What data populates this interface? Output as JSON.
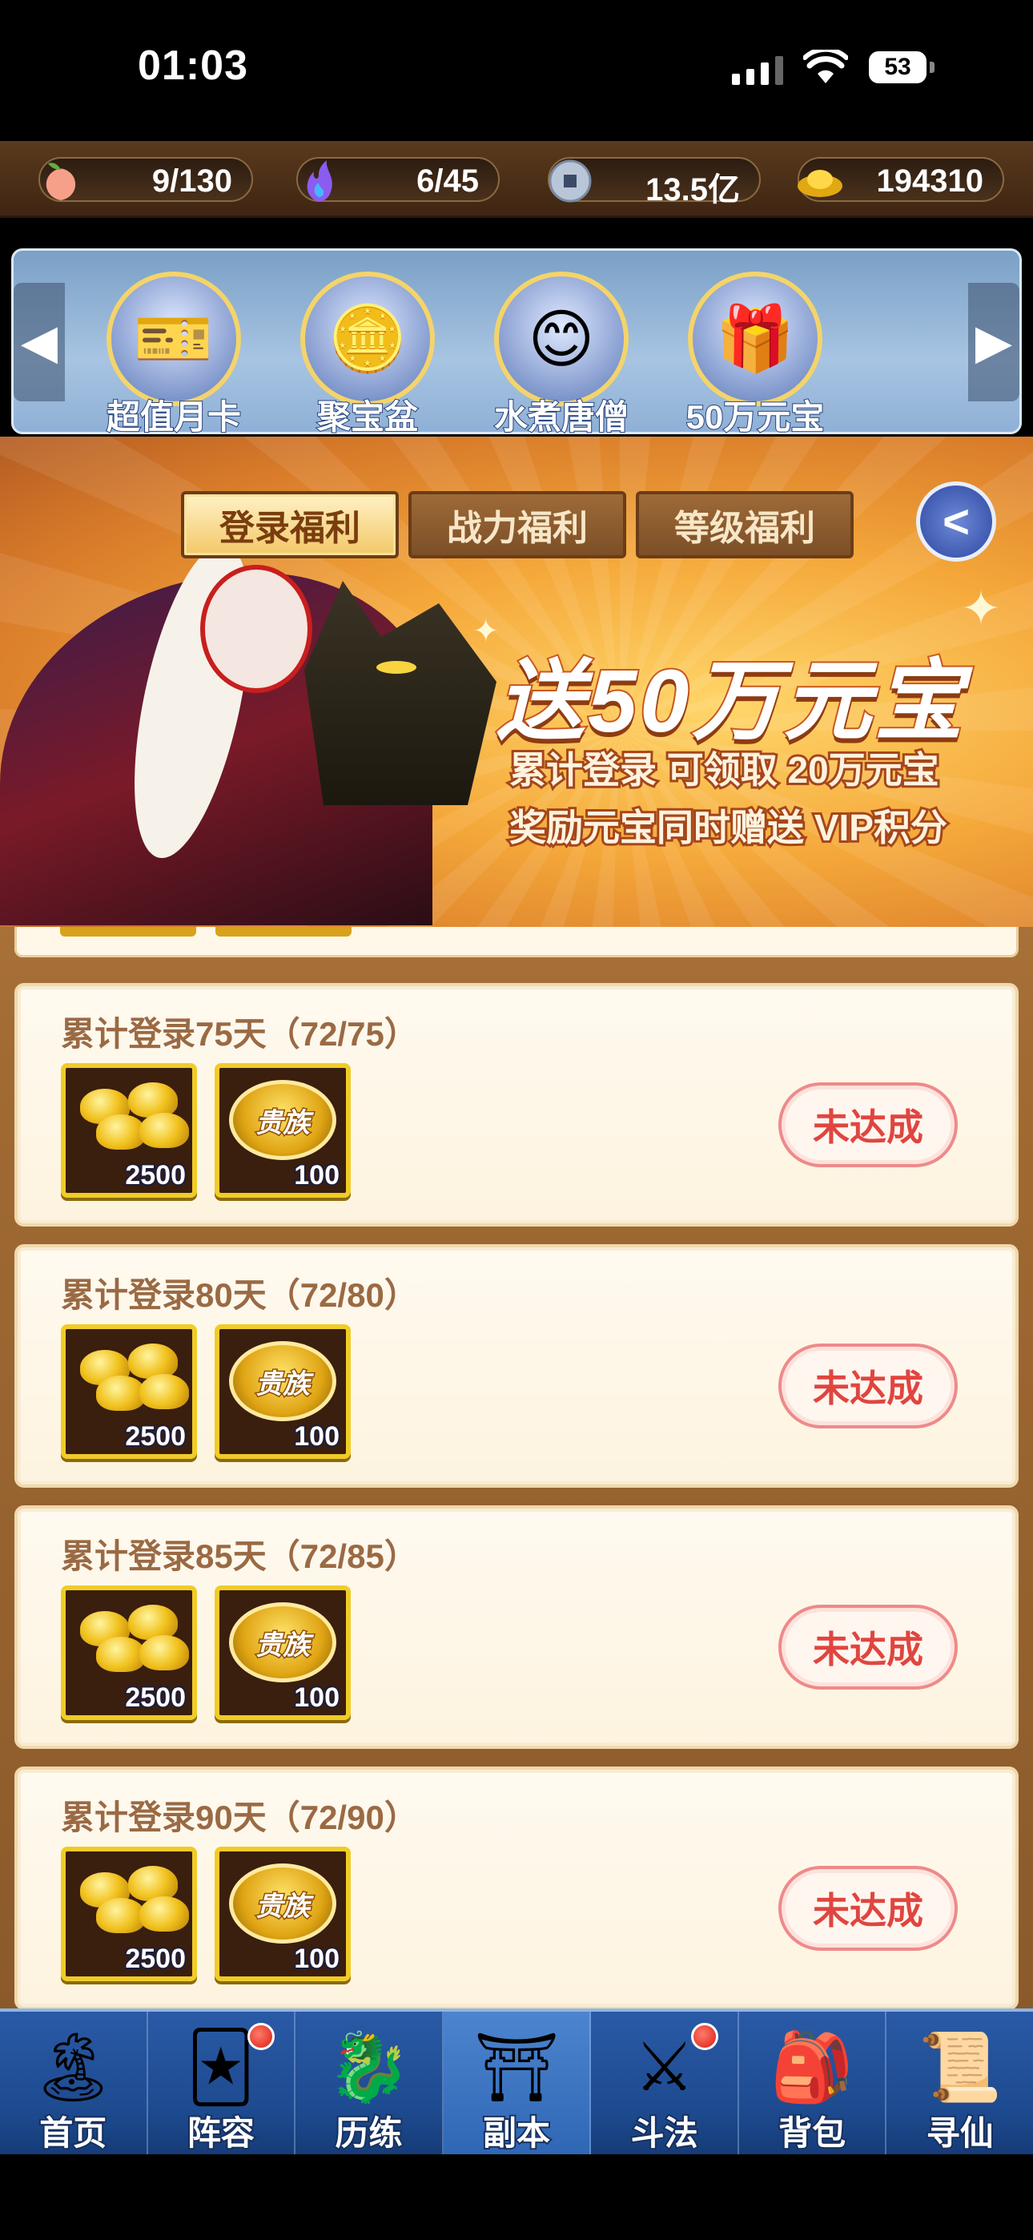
{
  "status_bar": {
    "time": "01:03",
    "battery": "53"
  },
  "resources": [
    {
      "icon": "peach-icon",
      "value": "9/130"
    },
    {
      "icon": "spirit-flame-icon",
      "value": "6/45"
    },
    {
      "icon": "copper-coin-icon",
      "value": "13.5亿"
    },
    {
      "icon": "gold-ingot-icon",
      "value": "194310"
    }
  ],
  "activities": [
    {
      "label": "超值月卡",
      "icon": "monthly-card-icon"
    },
    {
      "label": "聚宝盆",
      "icon": "treasure-bowl-icon"
    },
    {
      "label": "水煮唐僧",
      "icon": "monk-icon"
    },
    {
      "label": "50万元宝",
      "icon": "treasure-chest-icon"
    }
  ],
  "tabs": [
    {
      "label": "登录福利",
      "active": true
    },
    {
      "label": "战力福利",
      "active": false
    },
    {
      "label": "等级福利",
      "active": false
    }
  ],
  "banner": {
    "title": "送50万元宝",
    "line1": "累计登录 可领取 20万元宝",
    "line2": "奖励元宝同时赠送 VIP积分"
  },
  "rewards": [
    {
      "title": "累计登录75天（72/75）",
      "items": [
        {
          "type": "gold-ingot",
          "qty": "2500"
        },
        {
          "type": "noble",
          "label": "贵族",
          "qty": "100"
        }
      ],
      "status": "未达成"
    },
    {
      "title": "累计登录80天（72/80）",
      "items": [
        {
          "type": "gold-ingot",
          "qty": "2500"
        },
        {
          "type": "noble",
          "label": "贵族",
          "qty": "100"
        }
      ],
      "status": "未达成"
    },
    {
      "title": "累计登录85天（72/85）",
      "items": [
        {
          "type": "gold-ingot",
          "qty": "2500"
        },
        {
          "type": "noble",
          "label": "贵族",
          "qty": "100"
        }
      ],
      "status": "未达成"
    },
    {
      "title": "累计登录90天（72/90）",
      "items": [
        {
          "type": "gold-ingot",
          "qty": "2500"
        },
        {
          "type": "noble",
          "label": "贵族",
          "qty": "100"
        }
      ],
      "status": "未达成"
    }
  ],
  "nav": [
    {
      "label": "首页",
      "icon": "home-island-icon",
      "badge": false,
      "active": false
    },
    {
      "label": "阵容",
      "icon": "lineup-cards-icon",
      "badge": true,
      "active": false
    },
    {
      "label": "历练",
      "icon": "training-gourd-icon",
      "badge": false,
      "active": false
    },
    {
      "label": "副本",
      "icon": "dungeon-gate-icon",
      "badge": false,
      "active": true
    },
    {
      "label": "斗法",
      "icon": "battle-crest-icon",
      "badge": true,
      "active": false
    },
    {
      "label": "背包",
      "icon": "backpack-icon",
      "badge": false,
      "active": false
    },
    {
      "label": "寻仙",
      "icon": "scroll-icon",
      "badge": false,
      "active": false
    }
  ]
}
